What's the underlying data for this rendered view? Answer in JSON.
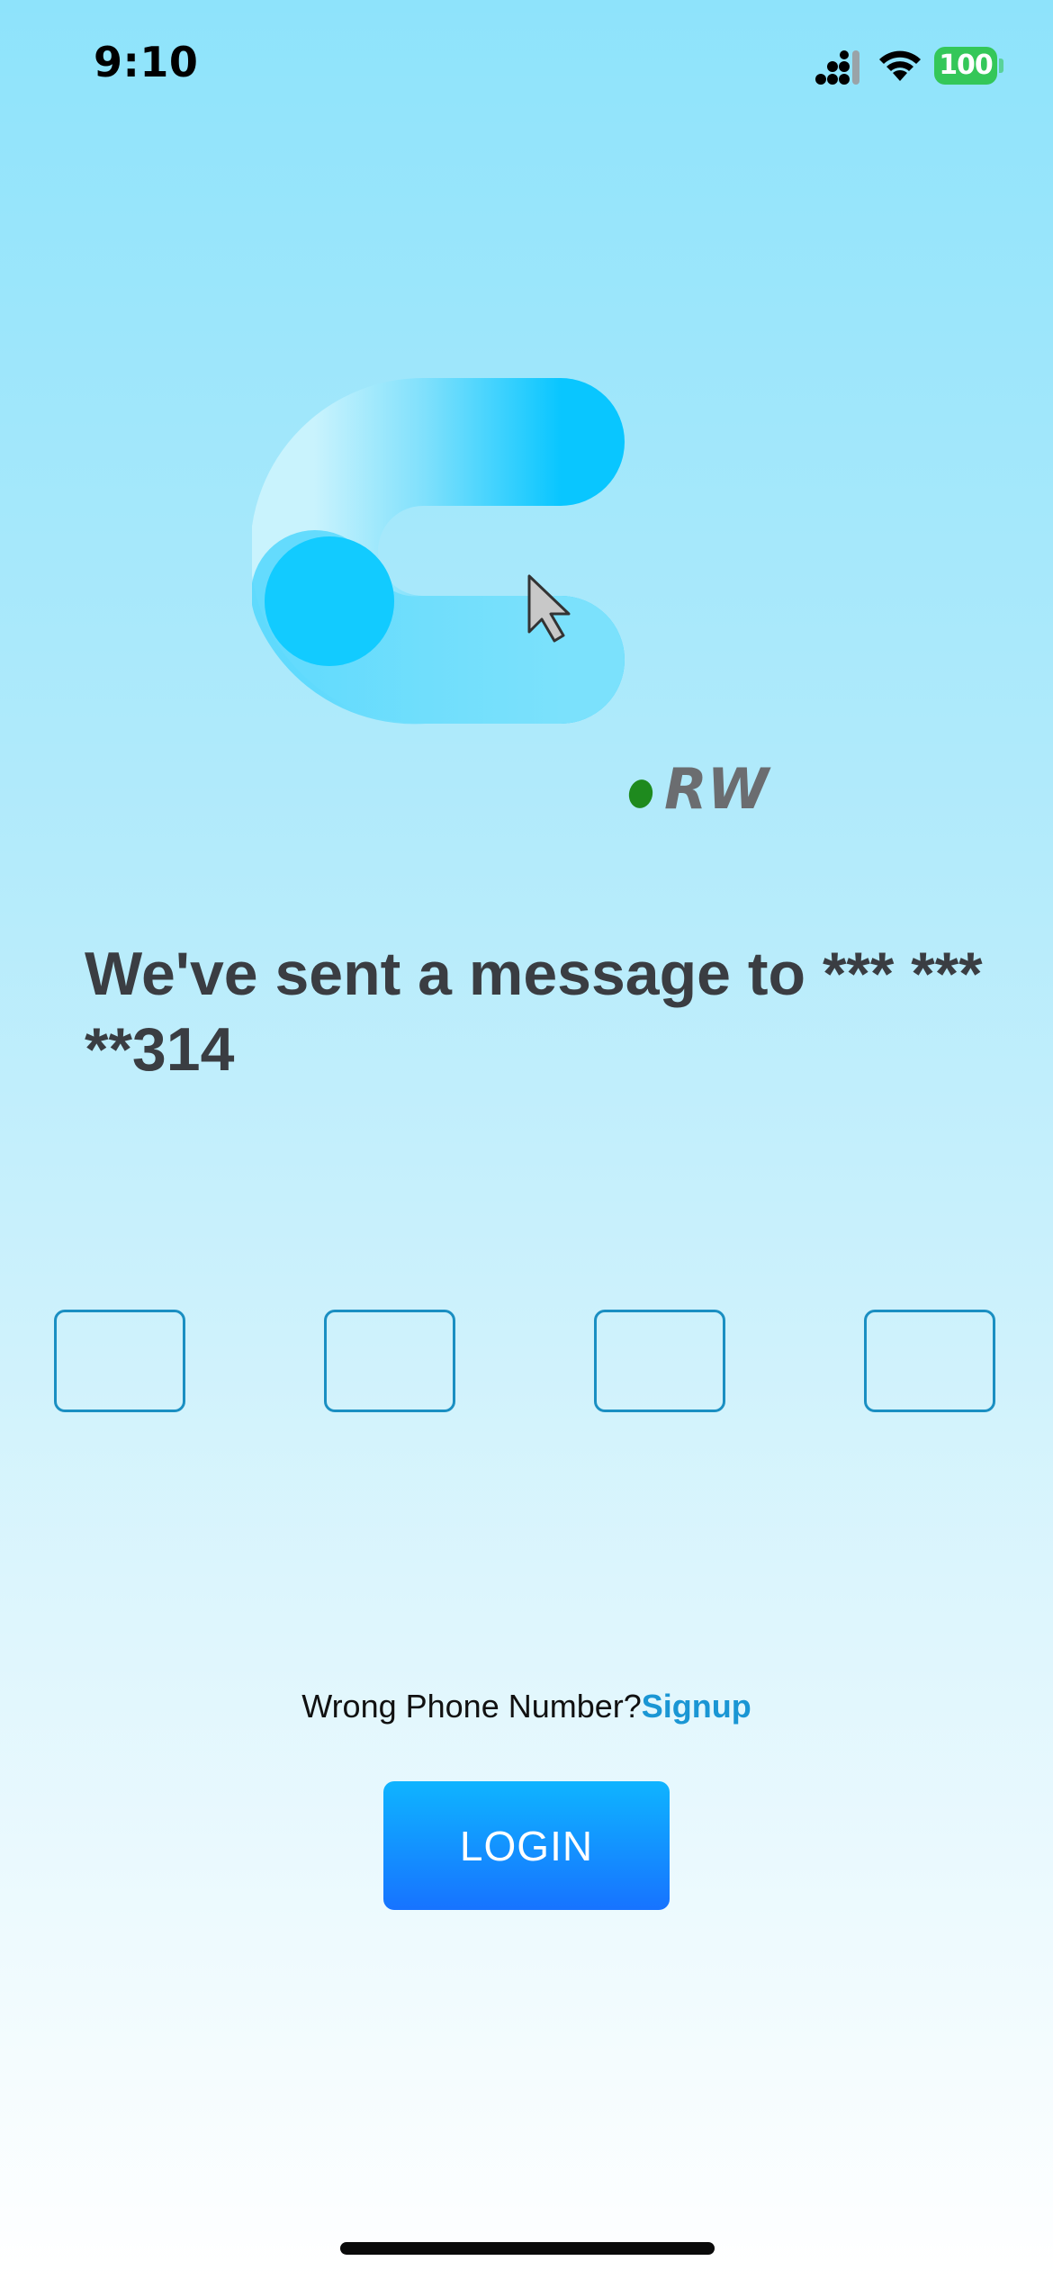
{
  "status_bar": {
    "time": "9:10",
    "battery_level": "100",
    "icons": [
      "signal-icon",
      "wifi-icon",
      "battery-icon"
    ]
  },
  "logo": {
    "suffix": "RW",
    "icon": "c-logo-with-cursor"
  },
  "heading": {
    "text": "We've sent a message to *** *** **314"
  },
  "otp": {
    "boxes": [
      "",
      "",
      "",
      ""
    ]
  },
  "signup": {
    "prompt": "Wrong Phone Number?",
    "link_label": "Signup"
  },
  "login_button": {
    "label": "LOGIN"
  },
  "colors": {
    "accent": "#1a96d4",
    "button_top": "#0fb4ff",
    "button_bottom": "#1773ff",
    "heading": "#3a3d42",
    "otp_border": "#1a8fc2",
    "battery": "#34c759"
  }
}
